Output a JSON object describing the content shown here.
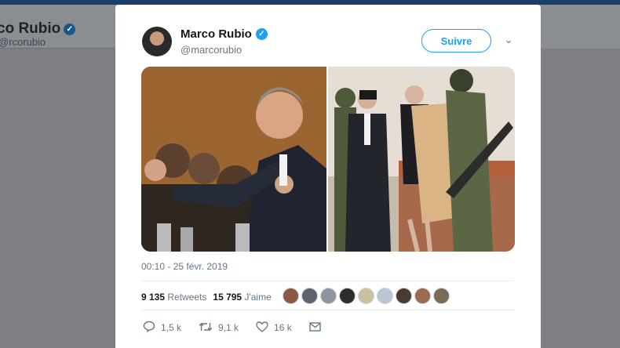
{
  "background": {
    "profile_name": "co Rubio",
    "profile_handle": "@rcorubio"
  },
  "tweet": {
    "author_name": "Marco Rubio",
    "author_handle": "@marcorubio",
    "verified": true,
    "follow_label": "Suivre",
    "timestamp": "00:10 - 25 févr. 2019",
    "retweets_count": "9 135",
    "retweets_label": "Retweets",
    "likes_count": "15 795",
    "likes_label": "J'aime",
    "liker_avatars": 9,
    "actions": {
      "reply_count": "1,5 k",
      "retweet_count": "9,1 k",
      "like_count": "16 k"
    }
  },
  "icons": {
    "verified": "verified-badge-icon",
    "caret": "chevron-down-icon",
    "reply": "reply-icon",
    "retweet": "retweet-icon",
    "like": "heart-icon",
    "dm": "envelope-icon"
  },
  "colors": {
    "accent": "#1da1f2",
    "secondary_text": "#657786",
    "overlay": "#7d7f82"
  }
}
